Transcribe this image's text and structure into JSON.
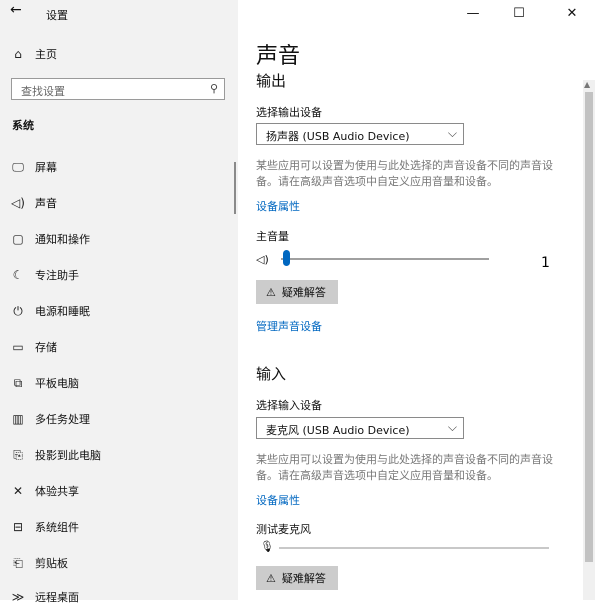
{
  "window": {
    "title": "设置",
    "back_icon": "←",
    "minimize": "—",
    "maximize": "☐",
    "close": "✕"
  },
  "sidebar": {
    "home_label": "主页",
    "search_placeholder": "查找设置",
    "section": "系统",
    "items": [
      {
        "icon": "🖵",
        "label": "屏幕"
      },
      {
        "icon": "🔊",
        "label": "声音"
      },
      {
        "icon": "🗨",
        "label": "通知和操作"
      },
      {
        "icon": "☾",
        "label": "专注助手"
      },
      {
        "icon": "⏻",
        "label": "电源和睡眠"
      },
      {
        "icon": "▭",
        "label": "存储"
      },
      {
        "icon": "⌨",
        "label": "平板电脑"
      },
      {
        "icon": "▥",
        "label": "多任务处理"
      },
      {
        "icon": "⎘",
        "label": "投影到此电脑"
      },
      {
        "icon": "✕",
        "label": "体验共享"
      },
      {
        "icon": "⊟",
        "label": "系统组件"
      },
      {
        "icon": "📋",
        "label": "剪贴板"
      },
      {
        "icon": "≫",
        "label": "远程桌面"
      }
    ]
  },
  "main": {
    "title": "声音",
    "output": {
      "heading": "输出",
      "device_label": "选择输出设备",
      "device_value": "扬声器 (USB Audio Device)",
      "description": "某些应用可以设置为使用与此处选择的声音设备不同的声音设备。请在高级声音选项中自定义应用音量和设备。",
      "properties_link": "设备属性",
      "volume_label": "主音量",
      "volume_value": "1",
      "volume_level": 1,
      "troubleshoot": "疑难解答",
      "manage_link": "管理声音设备"
    },
    "input": {
      "heading": "输入",
      "device_label": "选择输入设备",
      "device_value": "麦克风 (USB Audio Device)",
      "description": "某些应用可以设置为使用与此处选择的声音设备不同的声音设备。请在高级声音选项中自定义应用音量和设备。",
      "properties_link": "设备属性",
      "test_label": "测试麦克风",
      "troubleshoot": "疑难解答"
    }
  },
  "colors": {
    "accent": "#0067c0",
    "sidebar_bg": "#f2f2f2"
  }
}
